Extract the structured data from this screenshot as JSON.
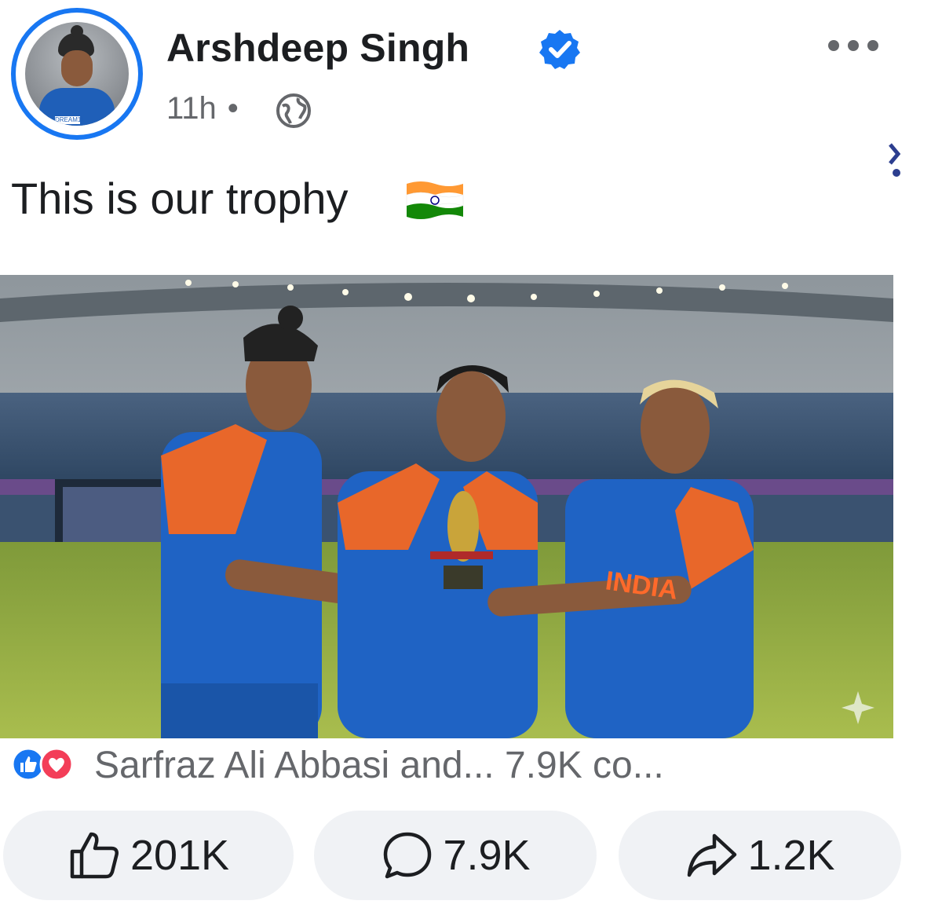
{
  "post": {
    "author": "Arshdeep Singh",
    "time": "11h",
    "separator": "•",
    "caption": "This is our trophy",
    "reactions_summary": "Sarfraz Ali Abbasi and... 7.9K co...",
    "actions": {
      "likes": "201K",
      "comments": "7.9K",
      "shares": "1.2K"
    }
  },
  "image_text": {
    "jersey": "INDIA",
    "avatar_sponsor": "DREAM11"
  },
  "icons": [
    "verified-badge-icon",
    "globe-icon",
    "more-options-icon",
    "india-flag-emoji",
    "like-reaction-icon",
    "love-reaction-icon",
    "thumbs-up-icon",
    "comment-icon",
    "share-icon"
  ],
  "colors": {
    "accent": "#1877f2",
    "love": "#f33e58",
    "button_bg": "#f0f2f5",
    "secondary_text": "#65676b"
  }
}
